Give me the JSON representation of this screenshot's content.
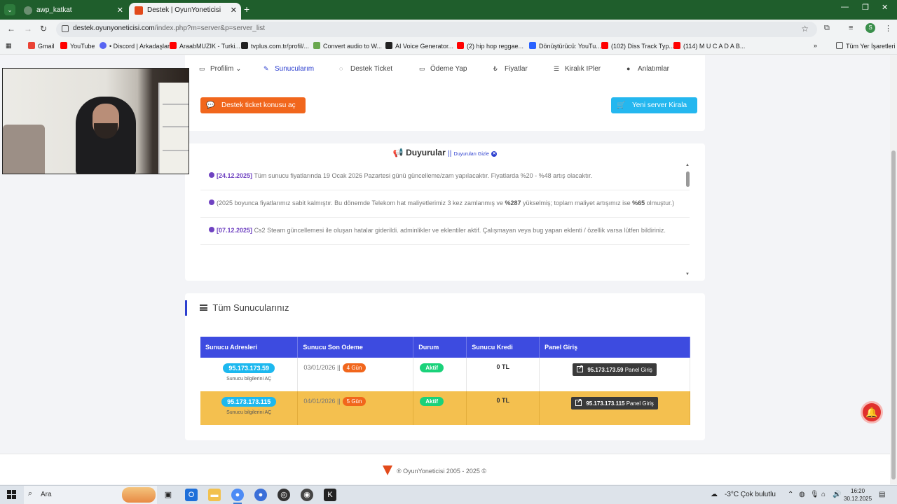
{
  "browser": {
    "tabs": [
      {
        "title": "awp_katkat"
      },
      {
        "title": "Destek | OyunYoneticisi Sistemi"
      }
    ],
    "url_host": "destek.oyunyoneticisi.com",
    "url_path": "/index.php?m=server&p=server_list",
    "profile_initial": "S",
    "bookmarks": [
      "Gmail",
      "YouTube",
      "• Discord | Arkadaşlar",
      "AraabMUZIK - Turki...",
      "tvplus.com.tr/profil/...",
      "Convert audio to W...",
      "AI Voice Generator...",
      "(2) hip hop reggae...",
      "Dönüştürücü: YouTu...",
      "(102) Diss Track Typ...",
      "(114) M U C A D A B..."
    ],
    "bookmarks_all": "Tüm Yer İşaretleri"
  },
  "nav": {
    "items": [
      "Profilim",
      "Sunucularım",
      "Destek Ticket",
      "Ödeme Yap",
      "Fiyatlar",
      "Kiralık IPler",
      "Anlatımlar"
    ]
  },
  "actions": {
    "ticket_button": "Destek ticket konusu aç",
    "rent_button": "Yeni server Kirala"
  },
  "announcements": {
    "title": "Duyurular",
    "separator": "||",
    "hide_label": "Duyuruları Gizle",
    "items": [
      {
        "date": "[24.12.2025]",
        "text": "Tüm sunucu fiyatlarında 19 Ocak 2026 Pazartesi günü güncelleme/zam yapılacaktır. Fiyatlarda %20 - %48 artış olacaktır."
      },
      {
        "pre": "(2025 boyunca fiyatlarımız sabit kalmıştır. Bu dönemde Telekom hat maliyetlerimiz 3 kez zamlanmış ve ",
        "b1": "%287",
        "mid": " yükselmiş; toplam maliyet artışımız ise ",
        "b2": "%65",
        "post": " olmuştur.)"
      },
      {
        "date": "[07.12.2025]",
        "text": "Cs2 Steam güncellemesi ile oluşan hatalar giderildi. adminlikler ve eklentiler aktif. Çalışmayan veya bug yapan eklenti / özellik varsa lütfen bildiriniz."
      }
    ]
  },
  "servers": {
    "title": "Tüm Sunucularınız",
    "columns": [
      "Sunucu Adresleri",
      "Sunucu Son Odeme",
      "Durum",
      "Sunucu Kredi",
      "Panel Giriş"
    ],
    "rows": [
      {
        "ip": "95.173.173.59",
        "info": "Sunucu bilgilerini AÇ",
        "due": "03/01/2026 ||",
        "days": "4 Gün",
        "status": "Aktif",
        "credit": "0 TL",
        "panel_ip": "95.173.173.59",
        "panel_label": "Panel Giriş"
      },
      {
        "ip": "95.173.173.115",
        "info": "Sunucu bilgilerini AÇ",
        "due": "04/01/2026 ||",
        "days": "5 Gün",
        "status": "Aktif",
        "credit": "0 TL",
        "panel_ip": "95.173.173.115",
        "panel_label": "Panel Giriş"
      }
    ]
  },
  "footer": {
    "text": "® OyunYoneticisi 2005 - 2025 ©"
  },
  "taskbar": {
    "search_placeholder": "Ara",
    "weather": "-3°C  Çok bulutlu",
    "time": "16:20",
    "date": "30.12.2025"
  }
}
